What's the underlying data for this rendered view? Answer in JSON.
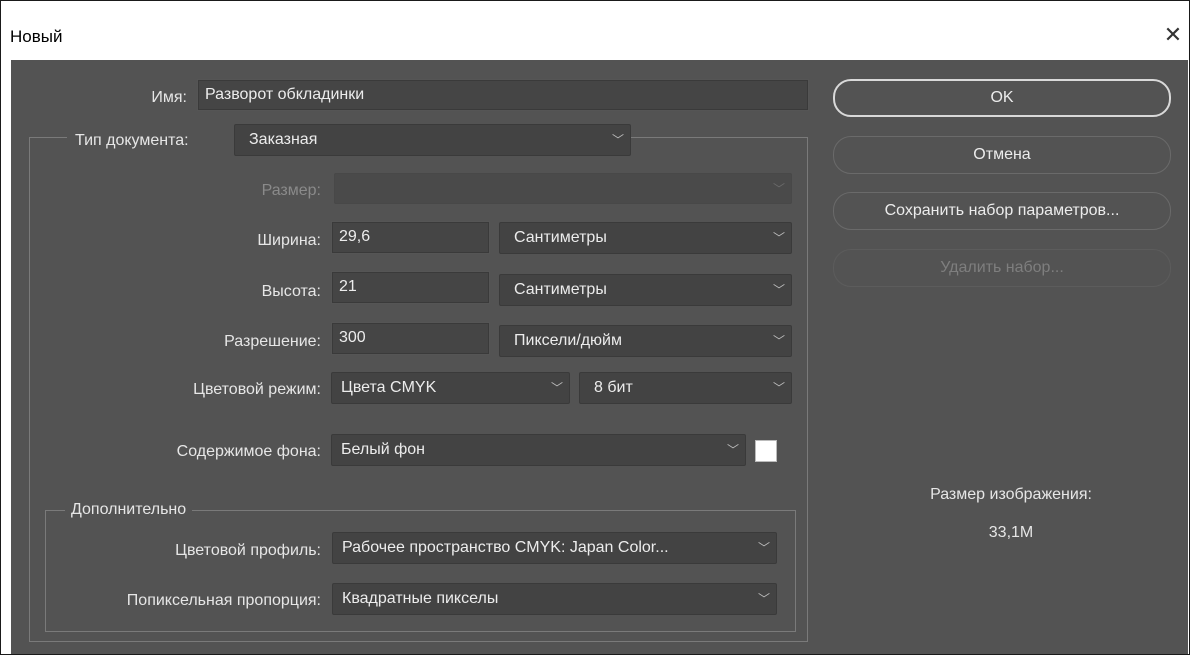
{
  "window": {
    "title": "Новый"
  },
  "form": {
    "name_label": "Имя:",
    "name_value": "Разворот обкладинки",
    "doctype_label": "Тип документа:",
    "doctype_value": "Заказная",
    "size_label": "Размер:",
    "size_value": "",
    "width_label": "Ширина:",
    "width_value": "29,6",
    "width_unit": "Сантиметры",
    "height_label": "Высота:",
    "height_value": "21",
    "height_unit": "Сантиметры",
    "resolution_label": "Разрешение:",
    "resolution_value": "300",
    "resolution_unit": "Пиксели/дюйм",
    "colormode_label": "Цветовой режим:",
    "colormode_value": "Цвета CMYK",
    "bitdepth_value": "8 бит",
    "background_label": "Содержимое фона:",
    "background_value": "Белый фон",
    "background_color": "#ffffff"
  },
  "advanced": {
    "legend": "Дополнительно",
    "profile_label": "Цветовой профиль:",
    "profile_value": "Рабочее пространство CMYK: Japan Color...",
    "aspect_label": "Попиксельная пропорция:",
    "aspect_value": "Квадратные пикселы"
  },
  "buttons": {
    "ok": "OK",
    "cancel": "Отмена",
    "save_preset": "Сохранить набор параметров...",
    "delete_preset": "Удалить набор..."
  },
  "info": {
    "image_size_label": "Размер изображения:",
    "image_size_value": "33,1M"
  },
  "icons": {
    "close": "close-icon",
    "dropdown": "chevron-down-icon"
  }
}
